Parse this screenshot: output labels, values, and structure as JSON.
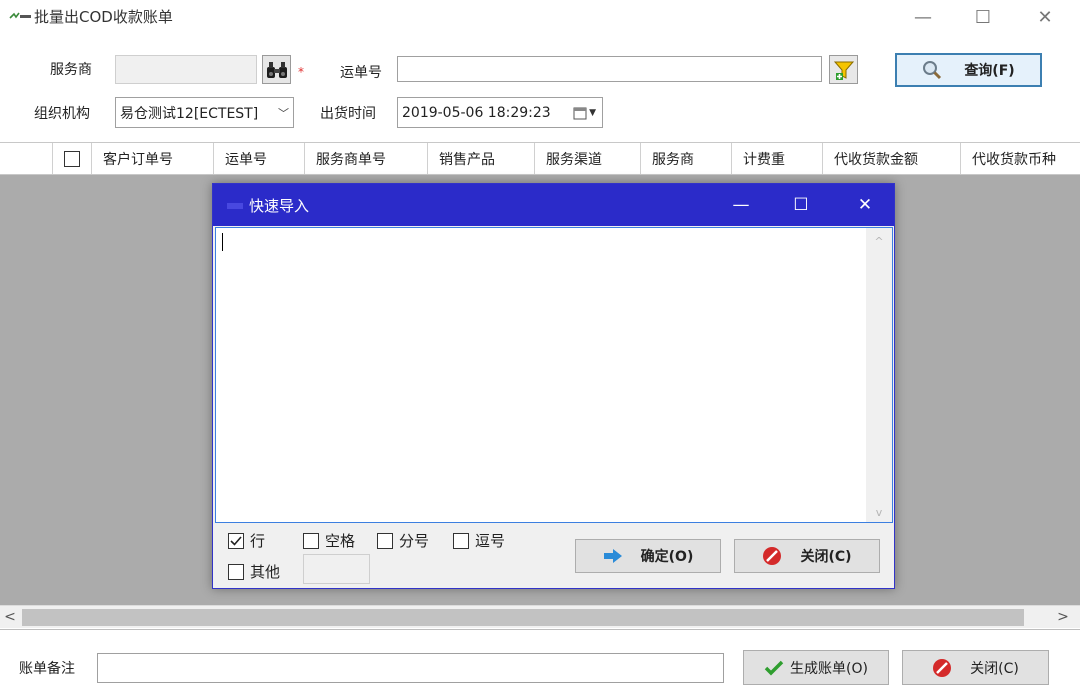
{
  "window": {
    "title": "批量出COD收款账单",
    "minimize": "—",
    "maximize": "☐",
    "close": "✕"
  },
  "form": {
    "service_provider_label": "服务商",
    "service_provider_value": "",
    "required_mark": "*",
    "waybill_label": "运单号",
    "waybill_value": "",
    "query_button": "查询(F)",
    "org_label": "组织机构",
    "org_value": "易仓测试12[ECTEST]",
    "ship_time_label": "出货时间",
    "ship_time_value": "2019-05-06 18:29:23"
  },
  "grid": {
    "columns": [
      "客户订单号",
      "运单号",
      "服务商单号",
      "销售产品",
      "服务渠道",
      "服务商",
      "计费重",
      "代收货款金额",
      "代收货款币种"
    ]
  },
  "scrollbar": {
    "left_arrow": "<",
    "right_arrow": ">"
  },
  "dialog": {
    "title": "快速导入",
    "minimize": "—",
    "maximize": "☐",
    "close": "✕",
    "text_value": "",
    "scroll_up": "^",
    "scroll_down": "v",
    "options": [
      {
        "label": "行",
        "checked": true
      },
      {
        "label": "空格",
        "checked": false
      },
      {
        "label": "分号",
        "checked": false
      },
      {
        "label": "逗号",
        "checked": false
      },
      {
        "label": "其他",
        "checked": false
      }
    ],
    "other_value": "",
    "confirm_button": "确定(O)",
    "close_button": "关闭(C)"
  },
  "footer": {
    "remark_label": "账单备注",
    "remark_value": "",
    "generate_button": "生成账单(O)",
    "close_button": "关闭(C)"
  },
  "colors": {
    "dialog_title_bg": "#2b2bc9",
    "grid_body_bg": "#ababab",
    "primary_border": "#3c7fb1"
  }
}
